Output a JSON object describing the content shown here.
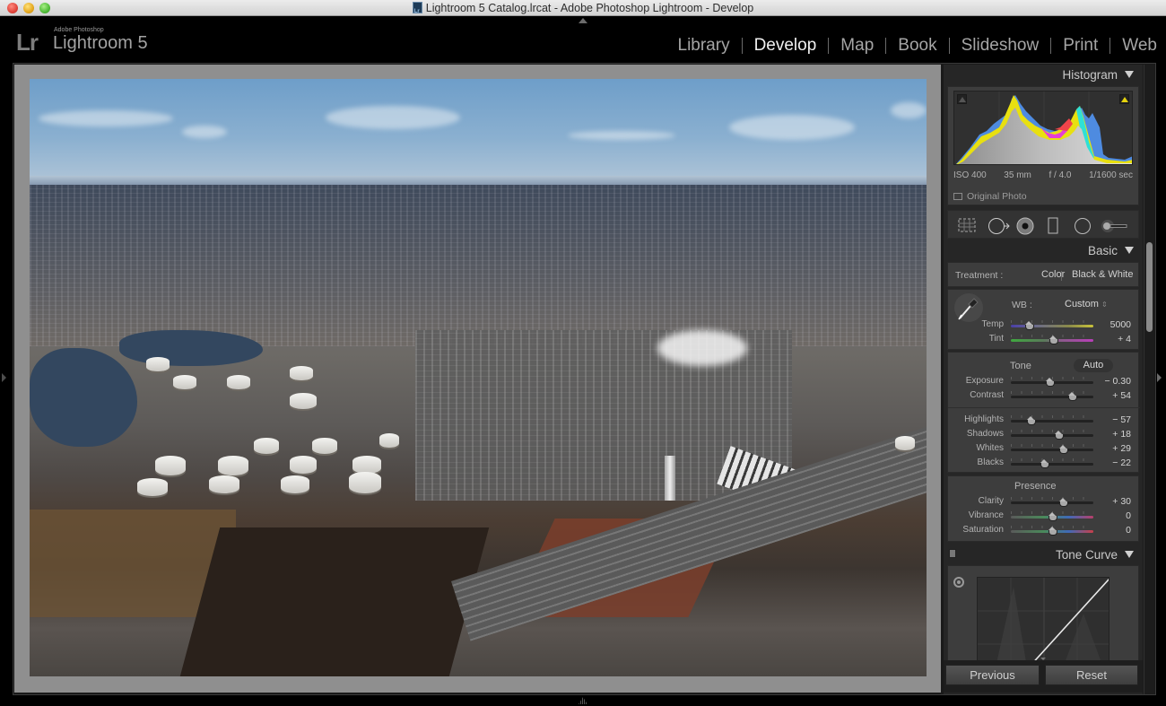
{
  "window": {
    "title": "Lightroom 5 Catalog.lrcat - Adobe Photoshop Lightroom - Develop"
  },
  "identity": {
    "logo": "Lr",
    "vendor": "Adobe Photoshop",
    "product": "Lightroom 5"
  },
  "modules": {
    "active": "Develop",
    "items": [
      {
        "label": "Library"
      },
      {
        "label": "Develop"
      },
      {
        "label": "Map"
      },
      {
        "label": "Book"
      },
      {
        "label": "Slideshow"
      },
      {
        "label": "Print"
      },
      {
        "label": "Web"
      }
    ]
  },
  "photo": {
    "description": "Aerial view of an oil refinery with storage tanks, river, highway and suburbs under a blue sky"
  },
  "histogram": {
    "title": "Histogram",
    "iso": "ISO 400",
    "focal_length": "35 mm",
    "aperture": "f / 4.0",
    "shutter": "1/1600 sec",
    "original_photo_label": "Original Photo",
    "original_photo_checked": false,
    "highlight_clipping_color": "#e4d20d"
  },
  "tools": [
    {
      "name": "crop-overlay-tool"
    },
    {
      "name": "spot-removal-tool"
    },
    {
      "name": "red-eye-tool"
    },
    {
      "name": "graduated-filter-tool"
    },
    {
      "name": "radial-filter-tool"
    },
    {
      "name": "adjustment-brush-tool"
    }
  ],
  "basic": {
    "title": "Basic",
    "treatment_label": "Treatment :",
    "treatment_options": [
      "Color",
      "Black & White"
    ],
    "treatment_selected": "Color",
    "wb_label": "WB :",
    "wb_value": "Custom",
    "tone_label": "Tone",
    "auto_label": "Auto",
    "presence_label": "Presence",
    "sliders": {
      "temp": {
        "label": "Temp",
        "value": "5000",
        "position": 0.22
      },
      "tint": {
        "label": "Tint",
        "value": "+ 4",
        "position": 0.51
      },
      "exposure": {
        "label": "Exposure",
        "value": "− 0.30",
        "position": 0.47
      },
      "contrast": {
        "label": "Contrast",
        "value": "+ 54",
        "position": 0.74
      },
      "highlights": {
        "label": "Highlights",
        "value": "− 57",
        "position": 0.24
      },
      "shadows": {
        "label": "Shadows",
        "value": "+ 18",
        "position": 0.58
      },
      "whites": {
        "label": "Whites",
        "value": "+ 29",
        "position": 0.63
      },
      "blacks": {
        "label": "Blacks",
        "value": "− 22",
        "position": 0.4
      },
      "clarity": {
        "label": "Clarity",
        "value": "+ 30",
        "position": 0.63
      },
      "vibrance": {
        "label": "Vibrance",
        "value": "0",
        "position": 0.5
      },
      "saturation": {
        "label": "Saturation",
        "value": "0",
        "position": 0.5
      }
    }
  },
  "tone_curve": {
    "title": "Tone Curve"
  },
  "buttons": {
    "previous": "Previous",
    "reset": "Reset"
  }
}
